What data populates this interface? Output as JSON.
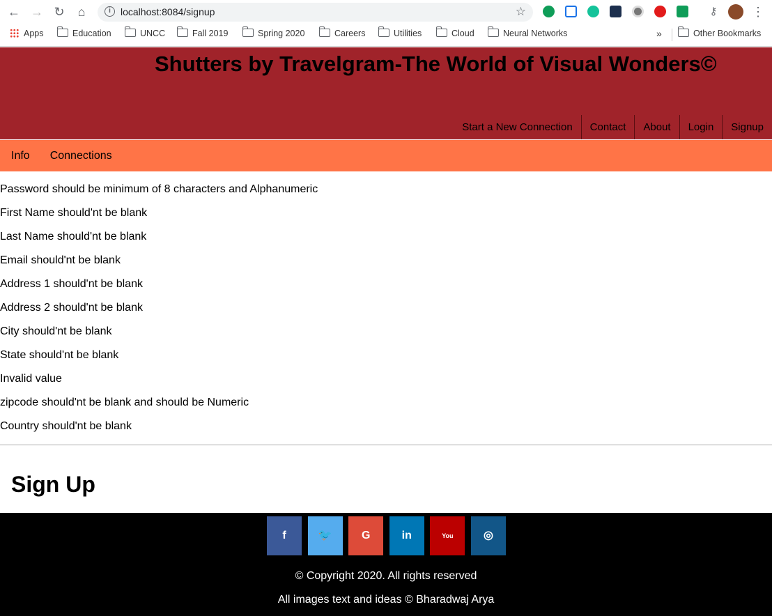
{
  "browser": {
    "url": "localhost:8084/signup",
    "bookmarks": [
      "Apps",
      "Education",
      "UNCC",
      "Fall 2019",
      "Spring 2020",
      "Careers",
      "Utilities",
      "Cloud",
      "Neural Networks"
    ],
    "overflow": "»",
    "other_bookmarks": "Other Bookmarks"
  },
  "header": {
    "title": "Shutters by Travelgram-The World of Visual Wonders©",
    "nav": [
      "Start a New Connection",
      "Contact",
      "About",
      "Login",
      "Signup"
    ]
  },
  "subnav": [
    "Info",
    "Connections"
  ],
  "errors": [
    "Password should be minimum of 8 characters and Alphanumeric",
    "First Name should'nt be blank",
    "Last Name should'nt be blank",
    "Email should'nt be blank",
    "Address 1 should'nt be blank",
    "Address 2 should'nt be blank",
    "City should'nt be blank",
    "State should'nt be blank",
    "Invalid value",
    "zipcode should'nt be blank and should be Numeric",
    "Country should'nt be blank"
  ],
  "main": {
    "heading": "Sign Up"
  },
  "footer": {
    "socials": [
      {
        "icon": "facebook-icon",
        "glyph": "f",
        "color": "#3b5998"
      },
      {
        "icon": "twitter-icon",
        "glyph": "🐦",
        "color": "#55acee"
      },
      {
        "icon": "google-icon",
        "glyph": "G",
        "color": "#dd4b39"
      },
      {
        "icon": "linkedin-icon",
        "glyph": "in",
        "color": "#0077b5"
      },
      {
        "icon": "youtube-icon",
        "glyph": "You",
        "color": "#bb0000"
      },
      {
        "icon": "instagram-icon",
        "glyph": "◎",
        "color": "#125688"
      }
    ],
    "copyright": "© Copyright 2020. All rights reserved",
    "credit": "All images text and ideas © Bharadwaj Arya"
  },
  "colors": {
    "header": "#a0232a",
    "subnav": "#ff7447",
    "footer": "#000000"
  }
}
